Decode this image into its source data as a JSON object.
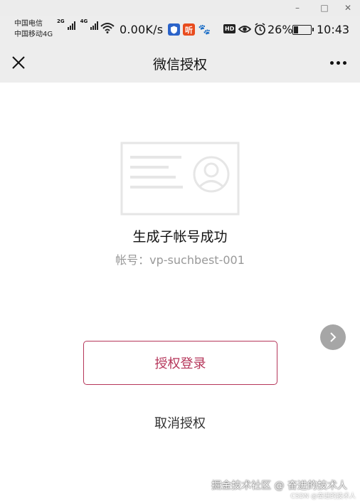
{
  "window": {
    "minimize_icon": "–",
    "maximize_icon": "□",
    "close_icon": "✕"
  },
  "status_bar": {
    "carrier_1": "中国电信",
    "carrier_2": "中国移动4G",
    "net_tag_1": "2G",
    "net_tag_2": "4G",
    "speed": "0.00K/s",
    "app_icon_2": "听",
    "app_icon_3": "🐾",
    "hd_badge": "HD",
    "battery_percent": "26%",
    "battery_level": 0.26,
    "time": "10:43"
  },
  "nav": {
    "title": "微信授权"
  },
  "main": {
    "success_title": "生成子帐号成功",
    "account_label": "帐号：",
    "account_value": "vp-suchbest-001",
    "auth_button_label": "授权登录",
    "cancel_label": "取消授权"
  },
  "watermark": {
    "line_1": "掘金技术社区 @ 奋进的技术人",
    "line_2": "CSDN @奋进的技术人"
  },
  "colors": {
    "accent": "#b5365a",
    "nav_background": "#ededed",
    "muted_text": "#999999"
  }
}
